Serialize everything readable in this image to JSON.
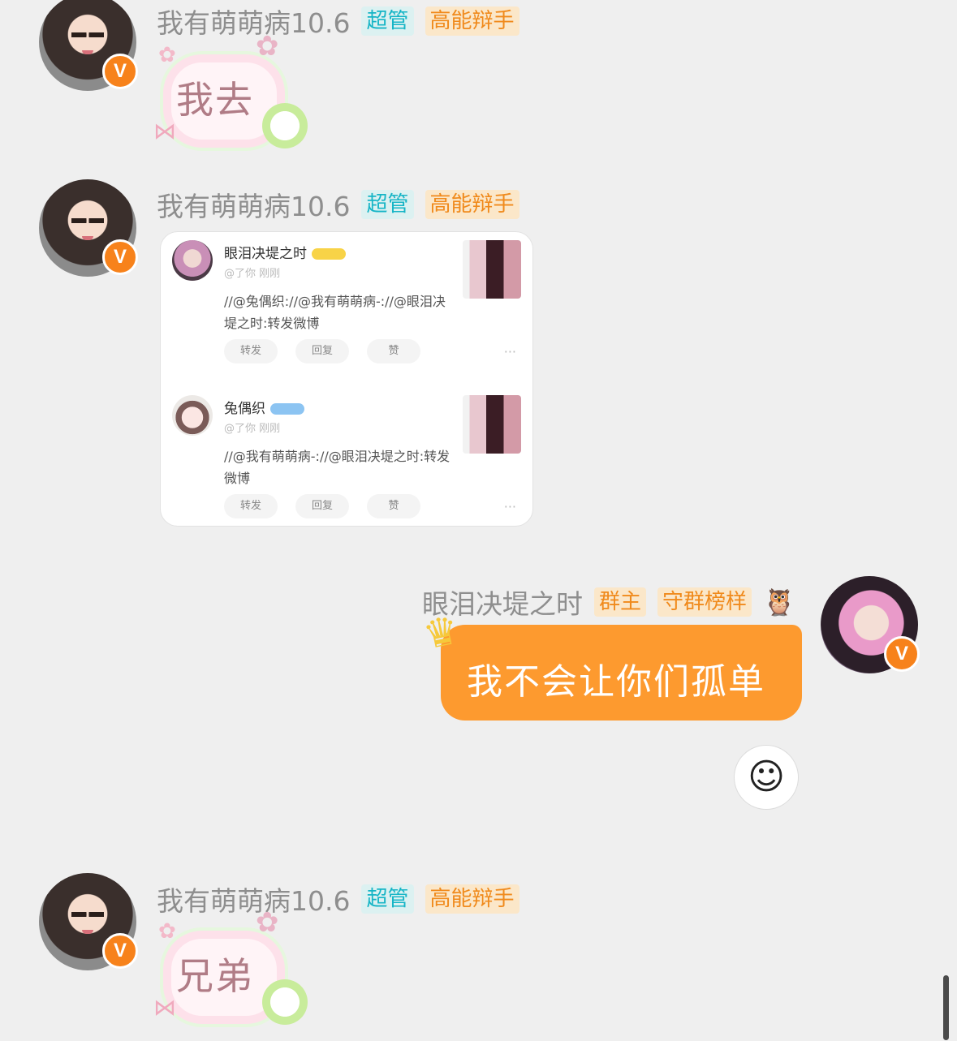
{
  "messages": [
    {
      "sender": "我有萌萌病10.6",
      "tags": [
        "超管",
        "高能辩手"
      ],
      "sticker_text": "我去",
      "verified_badge": "V"
    },
    {
      "sender": "我有萌萌病10.6",
      "tags": [
        "超管",
        "高能辩手"
      ],
      "verified_badge": "V",
      "card": {
        "posts": [
          {
            "name": "眼泪决堤之时",
            "meta": "@了你  刚刚",
            "text": "//@兔偶织://@我有萌萌病-://@眼泪决堤之时:转发微博",
            "actions": [
              "转发",
              "回复",
              "赞"
            ],
            "more": "···"
          },
          {
            "name": "兔偶织",
            "meta": "@了你  刚刚",
            "text": "//@我有萌萌病-://@眼泪决堤之时:转发微博",
            "actions": [
              "转发",
              "回复",
              "赞"
            ],
            "more": "···"
          }
        ]
      }
    },
    {
      "sender": "眼泪决堤之时",
      "tags": [
        "群主",
        "守群榜样"
      ],
      "owl": "🦉",
      "verified_badge": "V",
      "bubble_text": "我不会让你们孤单",
      "crown": "♛"
    },
    {
      "sender": "我有萌萌病10.6",
      "tags": [
        "超管",
        "高能辩手"
      ],
      "sticker_text": "兄弟",
      "verified_badge": "V"
    }
  ],
  "reaction_button": {
    "icon": "emoji-add-icon",
    "glyph": "☺"
  }
}
